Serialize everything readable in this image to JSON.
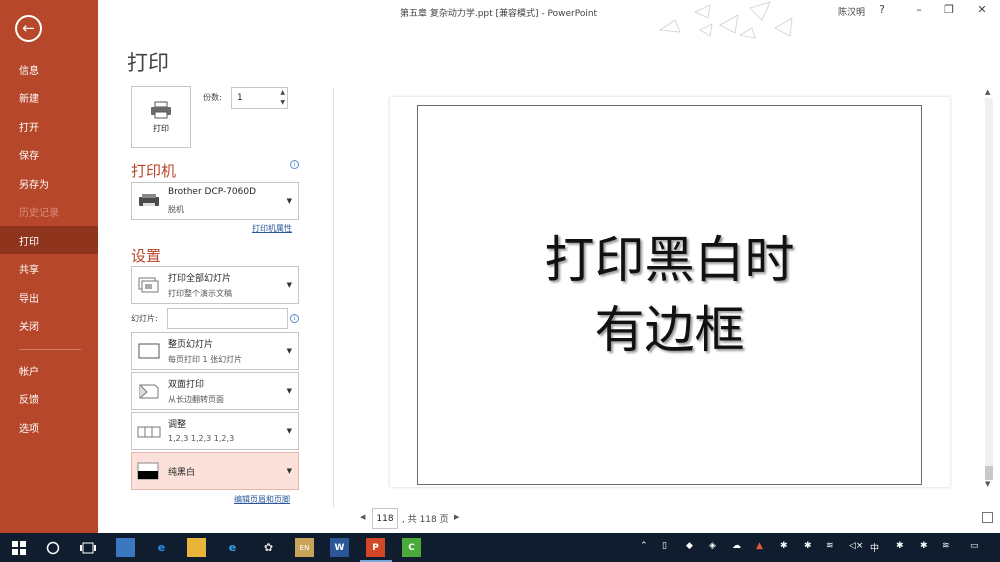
{
  "window": {
    "title": "第五章 复杂动力学.ppt [兼容模式] - PowerPoint",
    "user": "陈汉明",
    "help": "?",
    "minimize": "–",
    "restore": "❐",
    "close": "✕"
  },
  "sidebar": {
    "back": "←",
    "items": [
      {
        "label": "信息"
      },
      {
        "label": "新建"
      },
      {
        "label": "打开"
      },
      {
        "label": "保存"
      },
      {
        "label": "另存为"
      },
      {
        "label": "历史记录"
      },
      {
        "label": "打印"
      },
      {
        "label": "共享"
      },
      {
        "label": "导出"
      },
      {
        "label": "关闭"
      },
      {
        "label": "帐户"
      },
      {
        "label": "反馈"
      },
      {
        "label": "选项"
      }
    ]
  },
  "print": {
    "heading": "打印",
    "button_label": "打印",
    "copies_label": "份数:",
    "copies_value": "1",
    "printer_section": "打印机",
    "printer_name": "Brother DCP-7060D",
    "printer_status": "脱机",
    "printer_props_link": "打印机属性",
    "settings_section": "设置",
    "setting_range_title": "打印全部幻灯片",
    "setting_range_sub": "打印整个演示文稿",
    "slides_label": "幻灯片:",
    "slides_value": "",
    "setting_layout_title": "整页幻灯片",
    "setting_layout_sub": "每页打印 1 张幻灯片",
    "setting_duplex_title": "双面打印",
    "setting_duplex_sub": "从长边翻转页面",
    "setting_collate_title": "调整",
    "setting_collate_sub": "1,2,3    1,2,3    1,2,3",
    "setting_color_title": "纯黑白",
    "header_footer_link": "编辑页眉和页脚"
  },
  "preview": {
    "line1": "打印黑白时",
    "line2": "有边框",
    "page_current": "118",
    "page_total": ", 共 118 页"
  },
  "taskbar": {
    "tray_ime": "中"
  }
}
